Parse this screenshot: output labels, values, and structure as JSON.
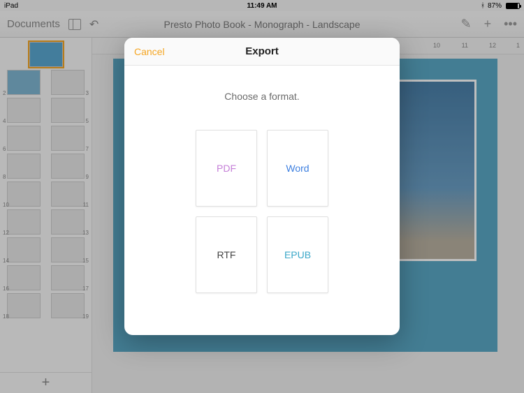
{
  "statusbar": {
    "device": "iPad",
    "time": "11:49 AM",
    "bluetooth": "✱",
    "battery_pct": "87%"
  },
  "toolbar": {
    "documents": "Documents",
    "title": "Presto Photo Book - Monograph - Landscape",
    "more": "•••",
    "plus": "+"
  },
  "ruler": {
    "ticks": [
      "10",
      "11",
      "12",
      "1"
    ]
  },
  "thumbs": {
    "numbers": [
      "",
      "2",
      "3",
      "4",
      "5",
      "6",
      "7",
      "8",
      "9",
      "10",
      "11",
      "12",
      "13",
      "14",
      "15",
      "16",
      "17",
      "18",
      "19"
    ],
    "add": "+"
  },
  "modal": {
    "cancel": "Cancel",
    "title": "Export",
    "subtitle": "Choose a format.",
    "formats": {
      "pdf": "PDF",
      "word": "Word",
      "rtf": "RTF",
      "epub": "EPUB"
    }
  }
}
